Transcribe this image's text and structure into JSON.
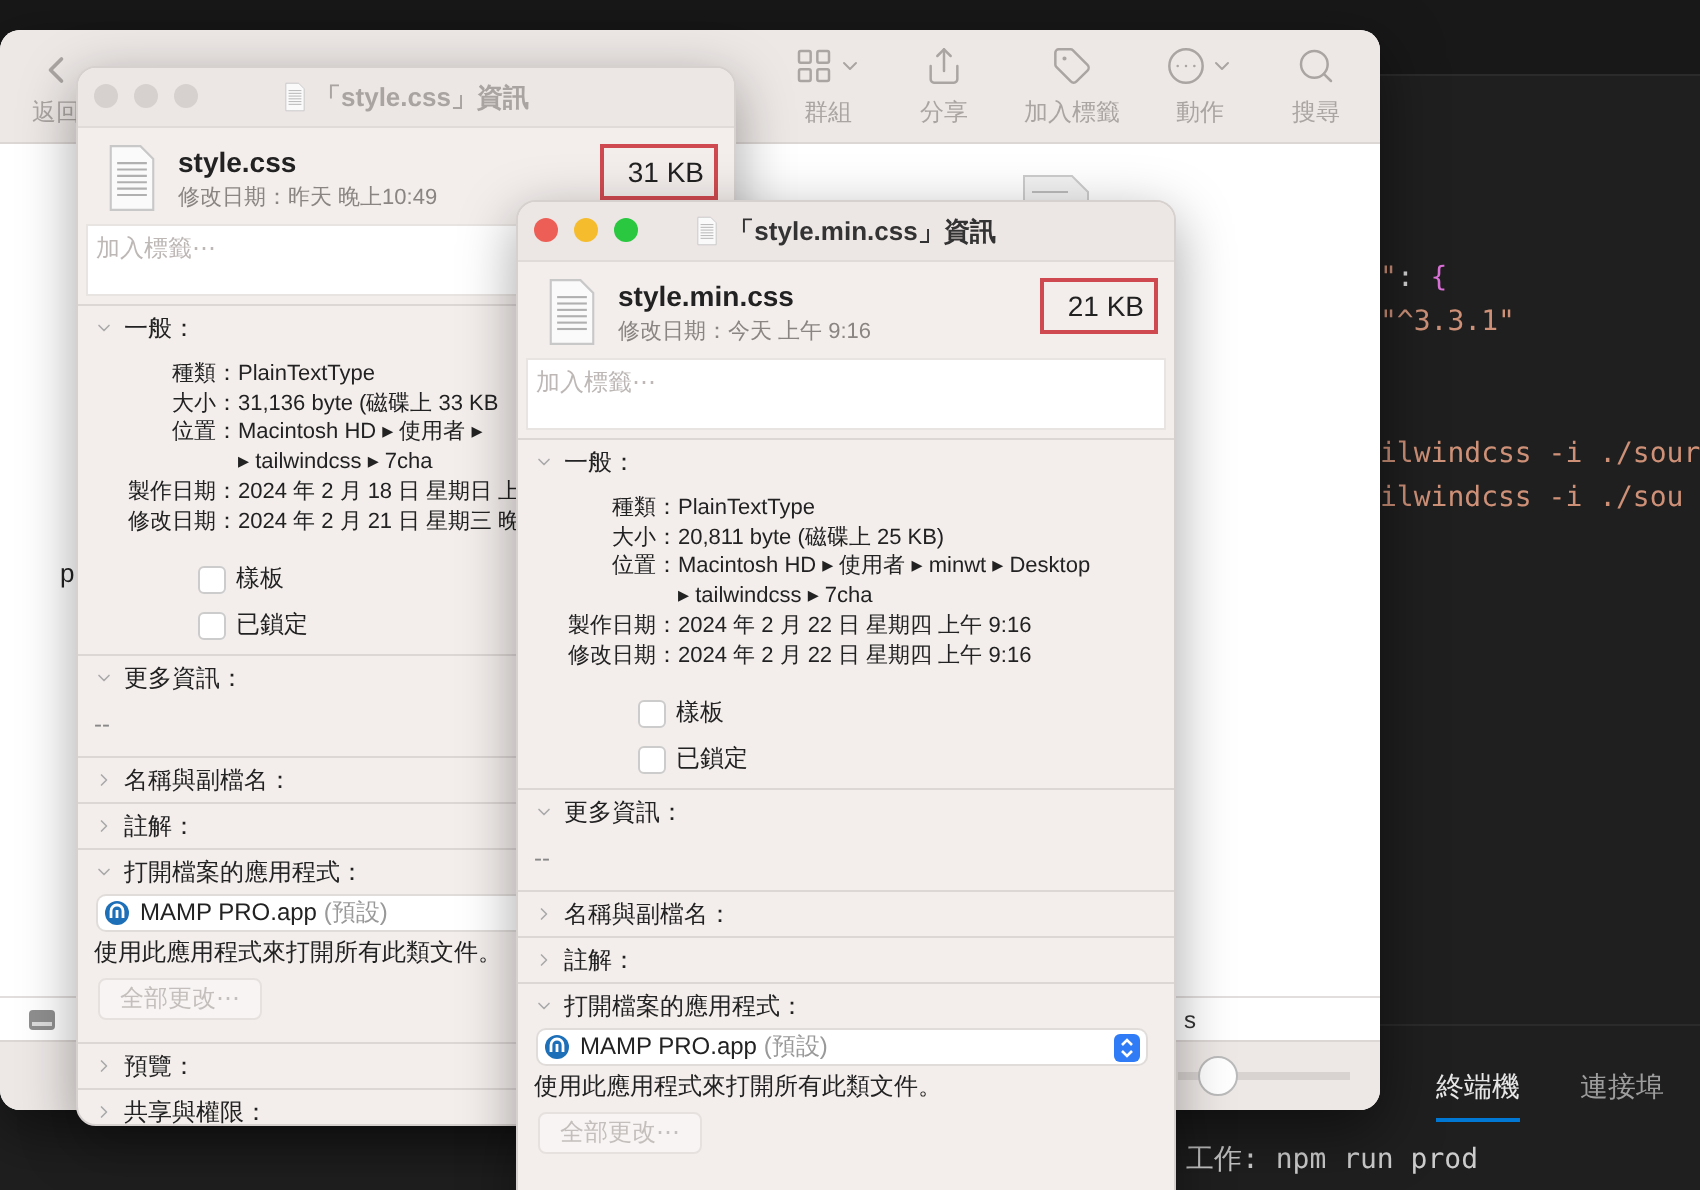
{
  "editor": {
    "code_blocks": [
      [
        [
          {
            "text": "\"",
            "kind": "string"
          },
          {
            "text": ": ",
            "kind": "punct"
          },
          {
            "text": "{",
            "kind": "brace"
          }
        ],
        [
          {
            "text": "\"^3.3.1\"",
            "kind": "string"
          }
        ]
      ],
      [
        [
          {
            "text": "ilwindcss -i ./sour",
            "kind": "string"
          }
        ],
        [
          {
            "text": "ilwindcss -i ./sou",
            "kind": "string"
          }
        ]
      ]
    ],
    "panel_tabs": [
      {
        "label": "終端機",
        "selected": true
      },
      {
        "label": "連接埠",
        "selected": false
      }
    ],
    "terminal_line": "工作: npm run prod"
  },
  "finder": {
    "back_label": "返回",
    "toolbar": [
      {
        "kind": "group",
        "label": "群組"
      },
      {
        "kind": "share",
        "label": "分享"
      },
      {
        "kind": "tag",
        "label": "加入標籤"
      },
      {
        "kind": "action",
        "label": "動作"
      },
      {
        "kind": "search",
        "label": "搜尋"
      }
    ],
    "item_fragment": "p",
    "status_fragment": "s",
    "zoom_slider": {
      "level": 0.2
    }
  },
  "info_windows": [
    {
      "active": false,
      "title": "「style.css」資訊",
      "file_name": "style.css",
      "modified": "修改日期：昨天 晚上10:49",
      "size": "31 KB",
      "tag_placeholder": "加入標籤⋯",
      "sections": [
        {
          "kind": "general",
          "title": "一般：",
          "expanded": true,
          "rows": [
            {
              "label": "種類：",
              "lines": [
                "PlainTextType"
              ]
            },
            {
              "label": "大小：",
              "lines": [
                "31,136 byte (磁碟上 33 KB"
              ]
            },
            {
              "label": "位置：",
              "lines": [
                "Macintosh HD ▸ 使用者 ▸",
                "▸ tailwindcss ▸ 7cha"
              ]
            },
            {
              "label": "製作日期：",
              "lines": [
                "2024 年 2 月 18 日 星期日 上"
              ]
            },
            {
              "label": "修改日期：",
              "lines": [
                "2024 年 2 月 21 日 星期三 晚"
              ]
            }
          ],
          "checkboxes": [
            {
              "label": "樣板",
              "checked": false
            },
            {
              "label": "已鎖定",
              "checked": false
            }
          ]
        },
        {
          "kind": "text",
          "title": "更多資訊：",
          "expanded": true,
          "text": "--"
        },
        {
          "kind": "plain",
          "title": "名稱與副檔名：",
          "expanded": false
        },
        {
          "kind": "plain",
          "title": "註解：",
          "expanded": false
        },
        {
          "kind": "app",
          "title": "打開檔案的應用程式：",
          "expanded": true,
          "app": "MAMP PRO.app",
          "app_note": "(預設)",
          "hint": "使用此應用程式來打開所有此類文件。",
          "button": "全部更改⋯"
        },
        {
          "kind": "plain",
          "title": "預覽：",
          "expanded": false
        },
        {
          "kind": "plain",
          "title": "共享與權限：",
          "expanded": false
        }
      ]
    },
    {
      "active": true,
      "title": "「style.min.css」資訊",
      "file_name": "style.min.css",
      "modified": "修改日期：今天 上午 9:16",
      "size": "21 KB",
      "tag_placeholder": "加入標籤⋯",
      "sections": [
        {
          "kind": "general",
          "title": "一般：",
          "expanded": true,
          "rows": [
            {
              "label": "種類：",
              "lines": [
                "PlainTextType"
              ]
            },
            {
              "label": "大小：",
              "lines": [
                "20,811 byte (磁碟上 25 KB)"
              ]
            },
            {
              "label": "位置：",
              "lines": [
                "Macintosh HD ▸ 使用者 ▸ minwt ▸ Desktop",
                "▸ tailwindcss ▸ 7cha"
              ]
            },
            {
              "label": "製作日期：",
              "lines": [
                "2024 年 2 月 22 日 星期四 上午 9:16"
              ]
            },
            {
              "label": "修改日期：",
              "lines": [
                "2024 年 2 月 22 日 星期四 上午 9:16"
              ]
            }
          ],
          "checkboxes": [
            {
              "label": "樣板",
              "checked": false
            },
            {
              "label": "已鎖定",
              "checked": false
            }
          ]
        },
        {
          "kind": "text",
          "title": "更多資訊：",
          "expanded": true,
          "text": "--"
        },
        {
          "kind": "plain",
          "title": "名稱與副檔名：",
          "expanded": false
        },
        {
          "kind": "plain",
          "title": "註解：",
          "expanded": false
        },
        {
          "kind": "app",
          "title": "打開檔案的應用程式：",
          "expanded": true,
          "app": "MAMP PRO.app",
          "app_note": "(預設)",
          "hint": "使用此應用程式來打開所有此類文件。",
          "button": "全部更改⋯"
        }
      ]
    }
  ]
}
